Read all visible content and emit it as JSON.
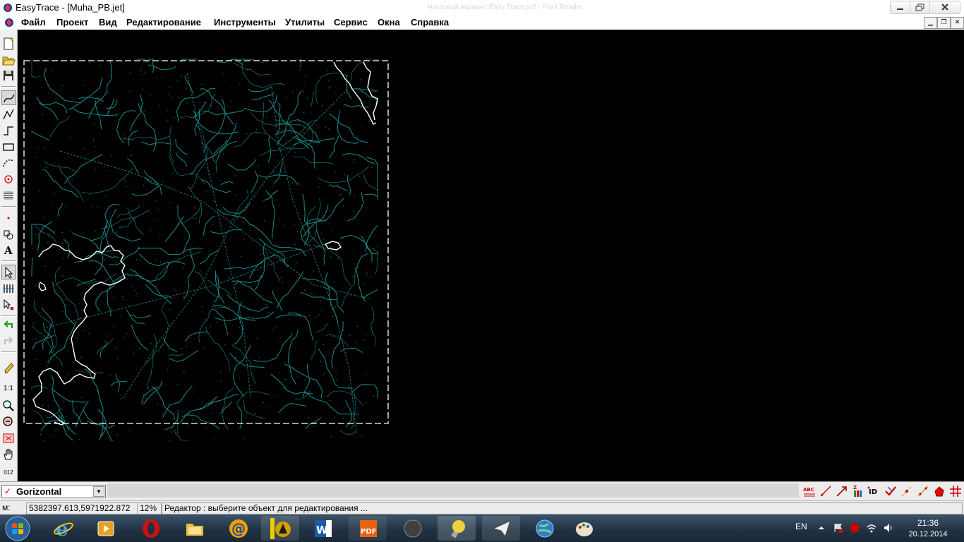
{
  "window": {
    "title": "EasyTrace - [Muha_PB.jet]",
    "faded_title": "Чистовой вариант Easy Trace.pdf - Foxit Reader"
  },
  "menu": {
    "items": [
      "Файл",
      "Проект",
      "Вид",
      "Редактирование",
      "Инструменты",
      "Утилиты",
      "Сервис",
      "Окна",
      "Справка"
    ]
  },
  "toolbar": {
    "scale_label": "1:1",
    "coord_label": "012"
  },
  "layer": {
    "name": "Gorizontal",
    "right_tools": [
      "ABC",
      "ID",
      "Z"
    ]
  },
  "status": {
    "label": "м:",
    "coords": "5382397.613,5971922.872",
    "zoom": "12%",
    "message": "Редактор : выберите объект для редактирования ..."
  },
  "tray": {
    "lang": "EN",
    "time": "21:36",
    "date": "20.12.2014"
  },
  "colors": {
    "map_lines": "#1a8a8a",
    "boundary": "#ffffff",
    "canvas": "#000000"
  }
}
